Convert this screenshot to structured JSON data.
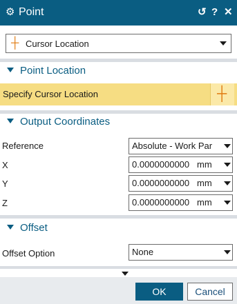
{
  "titlebar": {
    "icon": "gear-icon",
    "title": "Point",
    "reset_glyph": "↺",
    "help_glyph": "?",
    "close_glyph": "✕"
  },
  "type_selector": {
    "icon": "cursor-location-icon",
    "value": "Cursor Location"
  },
  "point_location": {
    "header": "Point Location",
    "specify_label": "Specify Cursor Location",
    "picker_icon": "crosshair-icon"
  },
  "output_coordinates": {
    "header": "Output Coordinates",
    "reference_label": "Reference",
    "reference_value": "Absolute - Work Par",
    "x_label": "X",
    "x_value": "0.0000000000",
    "x_unit": "mm",
    "y_label": "Y",
    "y_value": "0.0000000000",
    "y_unit": "mm",
    "z_label": "Z",
    "z_value": "0.0000000000",
    "z_unit": "mm"
  },
  "offset": {
    "header": "Offset",
    "option_label": "Offset Option",
    "option_value": "None"
  },
  "footer": {
    "ok_label": "OK",
    "cancel_label": "Cancel"
  },
  "colors": {
    "titlebar": "#0a5d82",
    "section_header": "#0a5d82",
    "selection_highlight": "#f6dd83",
    "crosshair": "#e07a10"
  }
}
